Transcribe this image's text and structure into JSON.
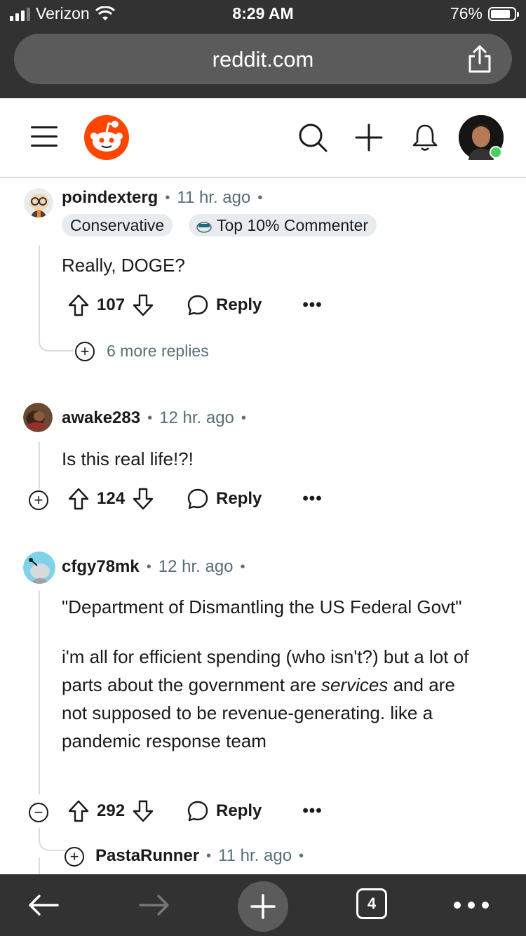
{
  "status_bar": {
    "carrier": "Verizon",
    "time": "8:29 AM",
    "battery_pct": "76%",
    "battery_level": 0.76
  },
  "browser": {
    "url": "reddit.com"
  },
  "header": {
    "icons": [
      "menu-icon",
      "reddit-logo",
      "search-icon",
      "create-icon",
      "notification-bell-icon",
      "user-avatar"
    ]
  },
  "comments": [
    {
      "username": "poindexterg",
      "time": "11 hr. ago",
      "flairs": [
        "Conservative",
        "Top 10% Commenter"
      ],
      "body": "Really, DOGE?",
      "votes": "107",
      "reply_label": "Reply",
      "more_label": "•••",
      "more_replies": "6 more replies"
    },
    {
      "username": "awake283",
      "time": "12 hr. ago",
      "body": "Is this real life!?!",
      "votes": "124",
      "reply_label": "Reply",
      "more_label": "•••"
    },
    {
      "username": "cfgy78mk",
      "time": "12 hr. ago",
      "body_p1": "\"Department of Dismantling the US Federal Govt\"",
      "body_p2_a": "i'm all for efficient spending (who isn't?) but a lot of parts about the government are ",
      "body_p2_em": "services",
      "body_p2_b": " and are not supposed to be revenue-generating. like a pandemic response team",
      "votes": "292",
      "reply_label": "Reply",
      "more_label": "•••"
    },
    {
      "username": "PastaRunner",
      "time": "11 hr. ago"
    }
  ],
  "toolbar": {
    "tab_count": "4"
  }
}
